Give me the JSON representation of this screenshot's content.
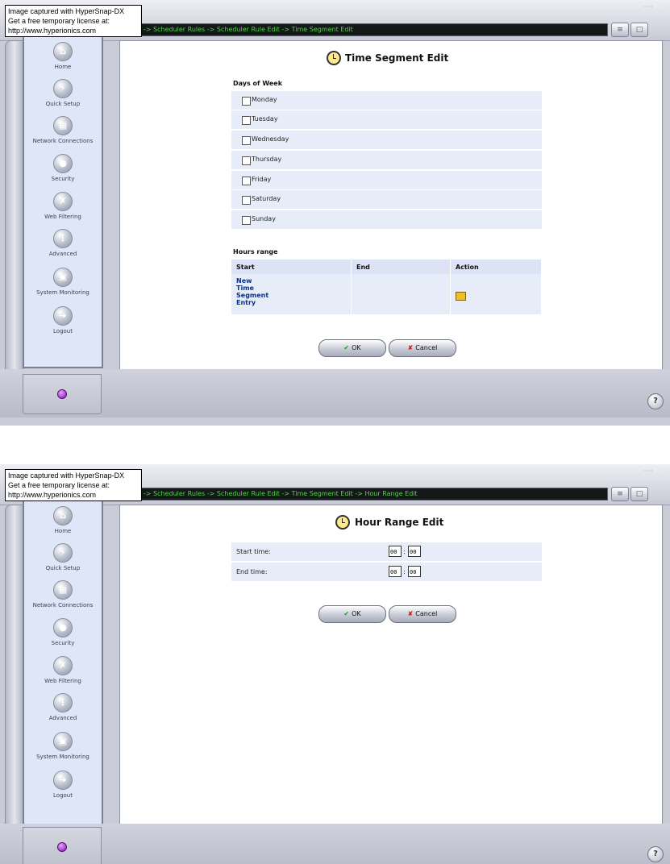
{
  "watermark": {
    "line1": "Image captured with HyperSnap-DX",
    "line2": "Get a free temporary license at:",
    "line3": "http://www.hyperionics.com"
  },
  "sidebar": {
    "items": [
      {
        "label": "Home",
        "icon": "home-icon"
      },
      {
        "label": "Quick Setup",
        "icon": "lightning-icon"
      },
      {
        "label": "Network Connections",
        "icon": "network-icon"
      },
      {
        "label": "Security",
        "icon": "lock-icon"
      },
      {
        "label": "Web Filtering",
        "icon": "filter-icon"
      },
      {
        "label": "Advanced",
        "icon": "advanced-icon"
      },
      {
        "label": "System Monitoring",
        "icon": "monitor-icon"
      },
      {
        "label": "Logout",
        "icon": "logout-icon"
      }
    ]
  },
  "screen1": {
    "breadcrumb": "anced -> Scheduler Rules -> Scheduler Rule Edit -> Time Segment Edit",
    "title": "Time Segment Edit",
    "days_title": "Days of Week",
    "days": [
      "Monday",
      "Tuesday",
      "Wednesday",
      "Thursday",
      "Friday",
      "Saturday",
      "Sunday"
    ],
    "hours_title": "Hours range",
    "columns": [
      "Start",
      "End",
      "Action"
    ],
    "new_entry": [
      "New",
      "Time",
      "Segment",
      "Entry"
    ],
    "ok_label": "OK",
    "cancel_label": "Cancel"
  },
  "screen2": {
    "breadcrumb": "anced -> Scheduler Rules -> Scheduler Rule Edit -> Time Segment Edit -> Hour Range Edit",
    "title": "Hour Range Edit",
    "start_label": "Start time:",
    "end_label": "End time:",
    "start_hour": "00",
    "start_minute": "00",
    "end_hour": "00",
    "end_minute": "00",
    "separator": ":",
    "ok_label": "OK",
    "cancel_label": "Cancel"
  },
  "colors": {
    "breadcrumb_text": "#4ad93f",
    "sidebar_bg": "#dfe6f7",
    "row_bg": "#e7edf8",
    "link": "#0b2f8a"
  }
}
